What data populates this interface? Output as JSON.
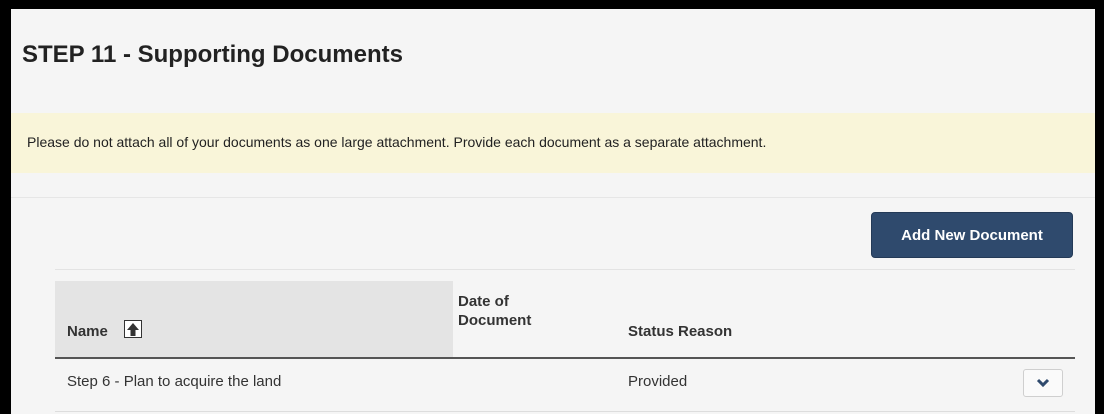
{
  "page": {
    "title": "STEP 11 - Supporting Documents",
    "notice": "Please do not attach all of your documents as one large attachment. Provide each document as a separate attachment.",
    "add_button_label": "Add New Document"
  },
  "table": {
    "columns": {
      "name": "Name",
      "date_line1": "Date of",
      "date_line2": "Document",
      "status": "Status Reason"
    },
    "sort_icon": "arrow-up-icon",
    "rows": [
      {
        "name": "Step 6 - Plan to acquire the land",
        "date": "",
        "status": "Provided",
        "action_icon": "chevron-down-icon"
      }
    ]
  },
  "colors": {
    "button": "#2f4a6d",
    "notice_bg": "#f9f5d9",
    "page_bg": "#f5f5f5"
  }
}
